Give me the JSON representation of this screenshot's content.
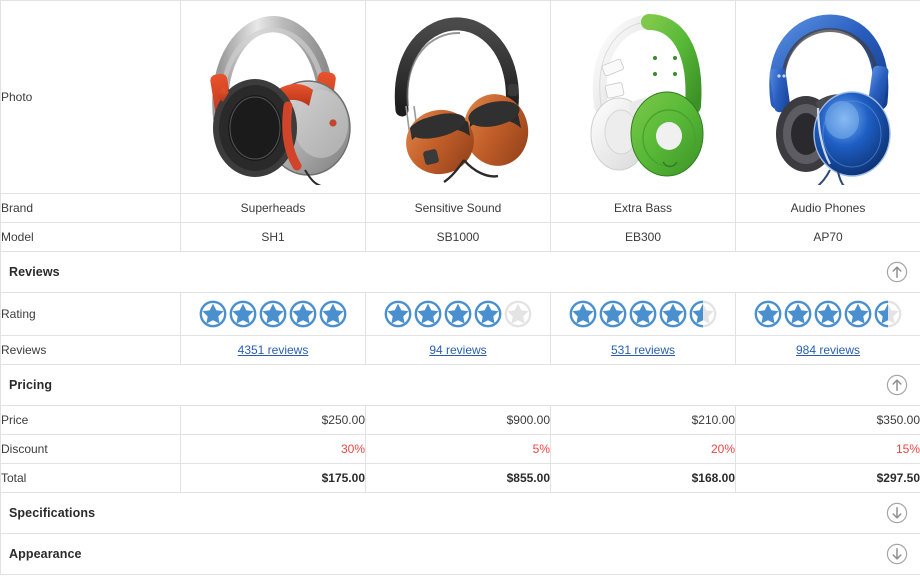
{
  "table": {
    "row_labels": {
      "photo": "Photo",
      "brand": "Brand",
      "model": "Model",
      "rating": "Rating",
      "reviews": "Reviews",
      "price": "Price",
      "discount": "Discount",
      "total": "Total"
    },
    "sections": [
      {
        "id": "reviews",
        "title": "Reviews",
        "icon": "arrow-up-circle-icon",
        "expanded": true
      },
      {
        "id": "pricing",
        "title": "Pricing",
        "icon": "arrow-up-circle-icon",
        "expanded": true
      },
      {
        "id": "specifications",
        "title": "Specifications",
        "icon": "arrow-down-circle-icon",
        "expanded": false
      },
      {
        "id": "appearance",
        "title": "Appearance",
        "icon": "arrow-down-circle-icon",
        "expanded": false
      }
    ],
    "products": [
      {
        "photo_alt": "silver-red-headphones-photo",
        "brand": "Superheads",
        "model": "SH1",
        "rating_stars": 5,
        "reviews_label": "4351 reviews",
        "price": "$250.00",
        "discount": "30%",
        "total": "$175.00"
      },
      {
        "photo_alt": "black-orange-headphones-photo",
        "brand": "Sensitive Sound",
        "model": "SB1000",
        "rating_stars": 4,
        "reviews_label": "94 reviews",
        "price": "$900.00",
        "discount": "5%",
        "total": "$855.00"
      },
      {
        "photo_alt": "green-white-headphones-photo",
        "brand": "Extra Bass",
        "model": "EB300",
        "rating_stars": 4.5,
        "reviews_label": "531 reviews",
        "price": "$210.00",
        "discount": "20%",
        "total": "$168.00"
      },
      {
        "photo_alt": "blue-headphones-photo",
        "brand": "Audio Phones",
        "model": "AP70",
        "rating_stars": 4.5,
        "reviews_label": "984 reviews",
        "price": "$350.00",
        "discount": "15%",
        "total": "$297.50"
      }
    ]
  },
  "colors": {
    "star_filled": "#4a90cf",
    "star_empty": "#e4e4e4",
    "link": "#2a5db0",
    "discount_text": "#ef4444",
    "border": "#e2e2e2",
    "text": "#3b3b3b",
    "toggle_icon": "#a6a6a6"
  }
}
